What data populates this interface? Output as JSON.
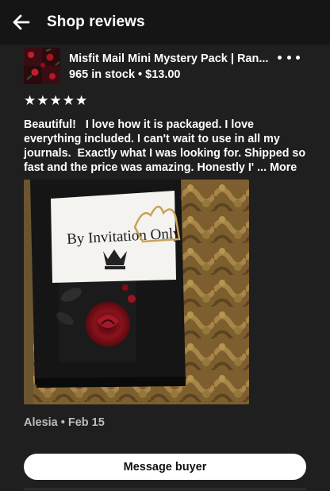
{
  "header": {
    "title": "Shop reviews",
    "back_icon": "arrow-left-icon"
  },
  "listing": {
    "title": "Misfit Mail Mini Mystery Pack | Ran...",
    "stock_price": "965 in stock • $13.00",
    "menu_icon": "more-horizontal-icon"
  },
  "review": {
    "rating": 5,
    "stars": [
      "★",
      "★",
      "★",
      "★",
      "★"
    ],
    "text": "Beautiful!   I love how it is packaged. I love everything included. I can't wait to use in all my journals.  Exactly what I was looking for. Shipped so fast and the price was amazing. Honestly I' ... ",
    "more_label": "More",
    "photo_text": "By Invitation Only",
    "reviewer": "Alesia • Feb 15"
  },
  "actions": {
    "message_label": "Message buyer"
  },
  "colors": {
    "background": "#1f1f1f",
    "header": "#151515",
    "text": "#ffffff",
    "muted": "#bdbdbd",
    "button": "#ffffff"
  }
}
